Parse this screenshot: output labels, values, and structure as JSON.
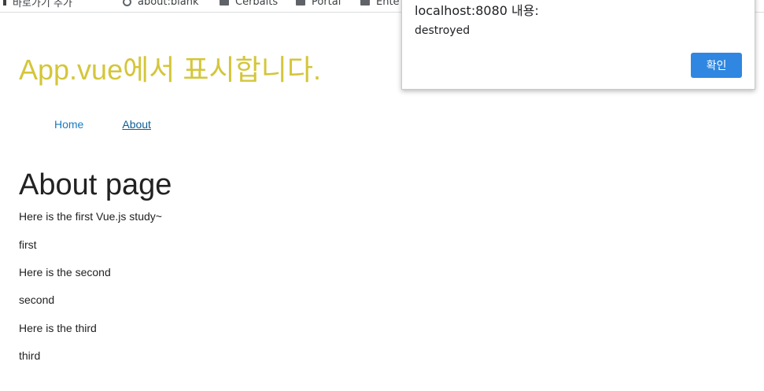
{
  "bookmarks": [
    {
      "label": "바로가기 추가",
      "icon": "bookmark-icon"
    },
    {
      "label": "about:blank",
      "icon": "globe-icon"
    },
    {
      "label": "Cerbaits",
      "icon": "folder-icon"
    },
    {
      "label": "Portal",
      "icon": "folder-icon"
    },
    {
      "label": "Ente",
      "icon": "folder-icon"
    }
  ],
  "app": {
    "title": "App.vue에서 표시합니다.",
    "title_color": "#d4c63a"
  },
  "nav": {
    "home": "Home",
    "about": "About"
  },
  "page": {
    "heading": "About page",
    "paragraphs": [
      "Here is the first Vue.js study~",
      "first",
      "Here is the second",
      "second",
      "Here is the third",
      "third"
    ]
  },
  "dialog": {
    "title": "localhost:8080 내용:",
    "message": "destroyed",
    "ok_label": "확인",
    "ok_color": "#2f87e1"
  }
}
